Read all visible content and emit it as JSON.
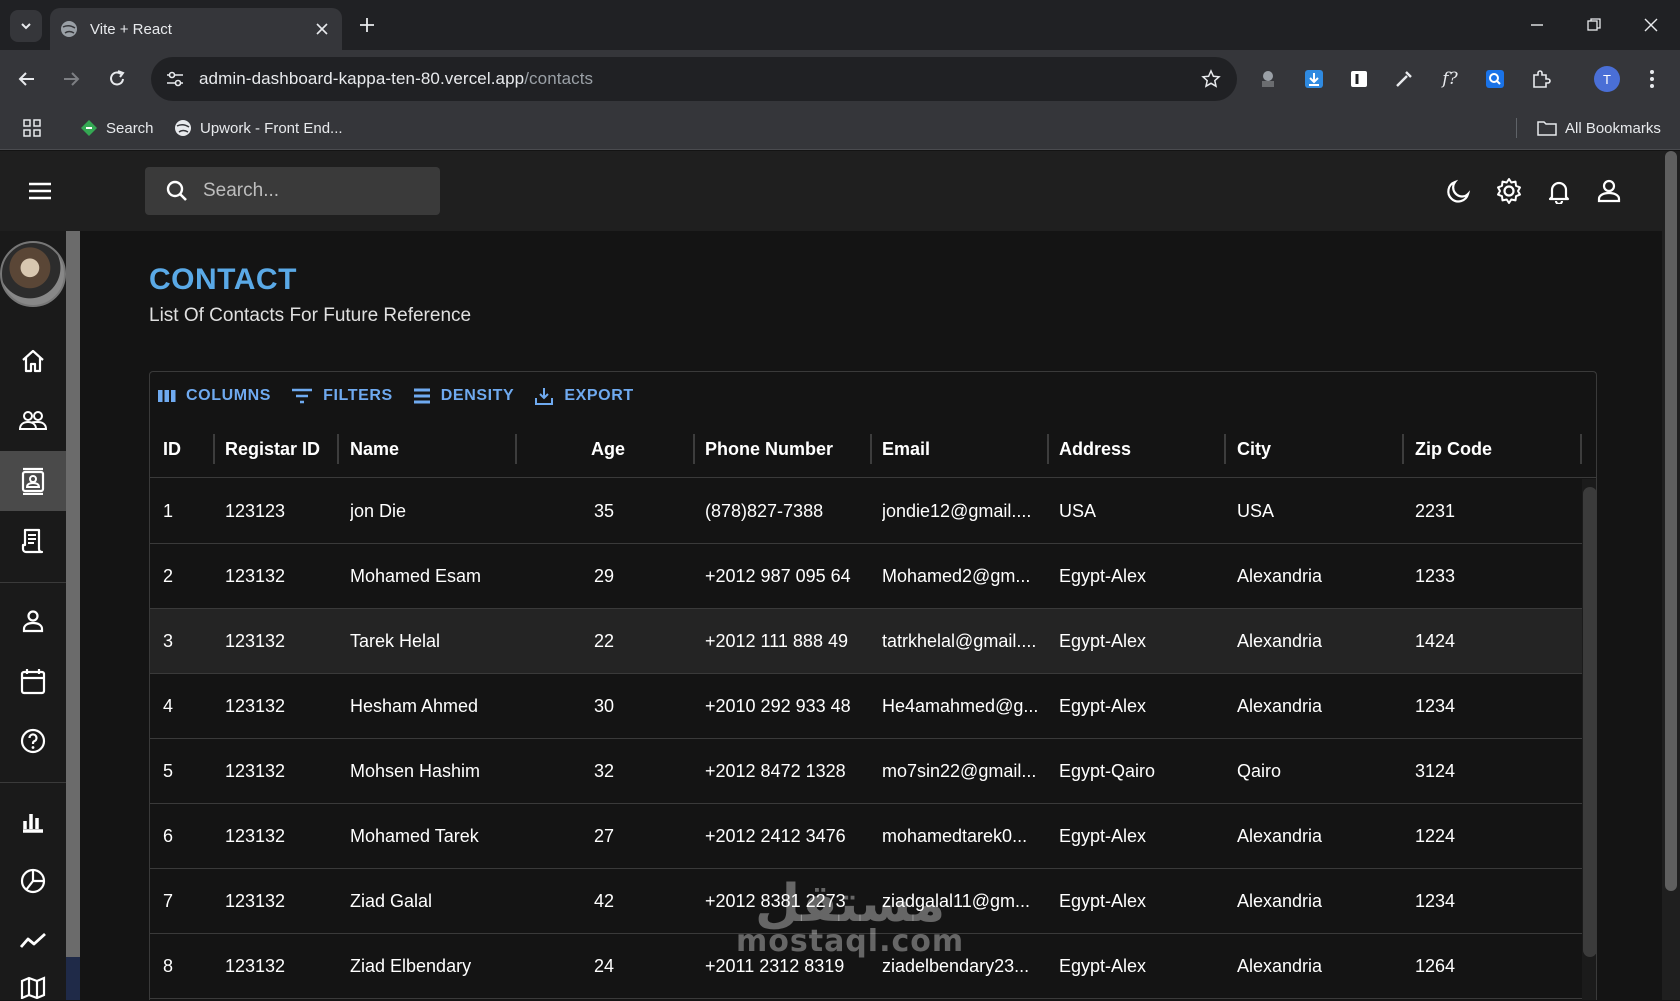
{
  "browser": {
    "tab_title": "Vite + React",
    "url_host": "admin-dashboard-kappa-ten-80.vercel.app",
    "url_path": "/contacts",
    "bookmarks": [
      {
        "label": "Search"
      },
      {
        "label": "Upwork - Front End..."
      }
    ],
    "all_bookmarks_label": "All Bookmarks",
    "profile_initial": "T"
  },
  "app": {
    "search_placeholder": "Search..."
  },
  "page": {
    "title": "CONTACT",
    "subtitle": "List Of Contacts For Future Reference"
  },
  "grid_toolbar": {
    "columns": "COLUMNS",
    "filters": "FILTERS",
    "density": "DENSITY",
    "export": "EXPORT"
  },
  "columns": [
    "ID",
    "Registar ID",
    "Name",
    "Age",
    "Phone Number",
    "Email",
    "Address",
    "City",
    "Zip Code"
  ],
  "rows": [
    {
      "id": "1",
      "registar_id": "123123",
      "name": "jon Die",
      "age": "35",
      "phone": "(878)827-7388",
      "email": "jondie12@gmail....",
      "address": "USA",
      "city": "USA",
      "zip": "2231"
    },
    {
      "id": "2",
      "registar_id": "123132",
      "name": "Mohamed Esam",
      "age": "29",
      "phone": "+2012 987 095 64",
      "email": "Mohamed2@gm...",
      "address": "Egypt-Alex",
      "city": "Alexandria",
      "zip": "1233"
    },
    {
      "id": "3",
      "registar_id": "123132",
      "name": "Tarek Helal",
      "age": "22",
      "phone": "+2012 111 888 49",
      "email": "tatrkhelal@gmail....",
      "address": "Egypt-Alex",
      "city": "Alexandria",
      "zip": "1424"
    },
    {
      "id": "4",
      "registar_id": "123132",
      "name": "Hesham Ahmed",
      "age": "30",
      "phone": "+2010 292 933 48",
      "email": "He4amahmed@g...",
      "address": "Egypt-Alex",
      "city": "Alexandria",
      "zip": "1234"
    },
    {
      "id": "5",
      "registar_id": "123132",
      "name": "Mohsen Hashim",
      "age": "32",
      "phone": "+2012 8472 1328",
      "email": "mo7sin22@gmail...",
      "address": "Egypt-Qairo",
      "city": "Qairo",
      "zip": "3124"
    },
    {
      "id": "6",
      "registar_id": "123132",
      "name": "Mohamed Tarek",
      "age": "27",
      "phone": "+2012 2412 3476",
      "email": "mohamedtarek0...",
      "address": "Egypt-Alex",
      "city": "Alexandria",
      "zip": "1224"
    },
    {
      "id": "7",
      "registar_id": "123132",
      "name": "Ziad Galal",
      "age": "42",
      "phone": "+2012 8381 2273",
      "email": "ziadgalal11@gm...",
      "address": "Egypt-Alex",
      "city": "Alexandria",
      "zip": "1234"
    },
    {
      "id": "8",
      "registar_id": "123132",
      "name": "Ziad Elbendary",
      "age": "24",
      "phone": "+2011 2312 8319",
      "email": "ziadelbendary23...",
      "address": "Egypt-Alex",
      "city": "Alexandria",
      "zip": "1264"
    }
  ],
  "watermark": {
    "arabic": "مستقل",
    "latin": "mostaql.com"
  },
  "colors": {
    "title": "#5aa9e6",
    "toolbar_buttons": "#6faaf0",
    "active_sidebar": "#4a4a4a"
  }
}
